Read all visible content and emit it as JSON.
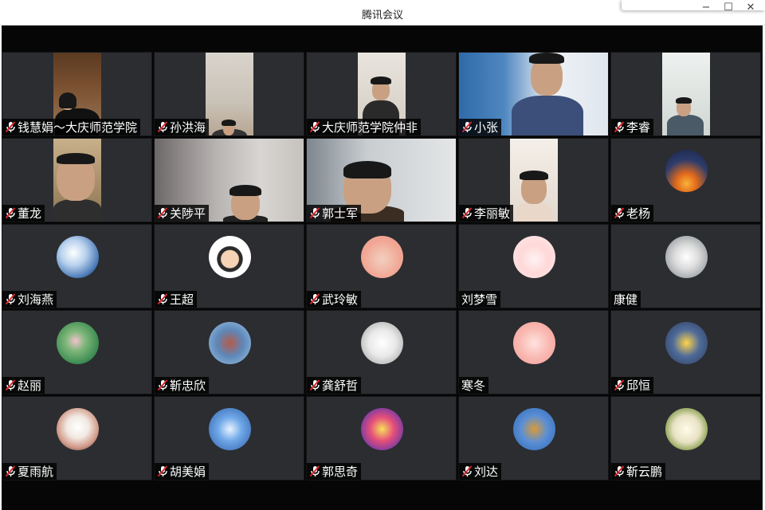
{
  "window": {
    "title": "腾讯会议",
    "controls": {
      "minimize": "−",
      "maximize": "☐",
      "close": "✕"
    }
  },
  "colors": {
    "stage_background": "#060606",
    "tile_background": "#2b2d31",
    "muted_mic": "#d9262c"
  },
  "participants": [
    {
      "name": "钱慧娟～大庆师范学院",
      "muted": true,
      "video": true
    },
    {
      "name": "孙洪海",
      "muted": true,
      "video": true
    },
    {
      "name": "大庆师范学院仲非",
      "muted": true,
      "video": true
    },
    {
      "name": "小张",
      "muted": true,
      "video": true
    },
    {
      "name": "李睿",
      "muted": true,
      "video": true
    },
    {
      "name": "董龙",
      "muted": true,
      "video": true
    },
    {
      "name": "关陟平",
      "muted": true,
      "video": true
    },
    {
      "name": "郭士军",
      "muted": true,
      "video": true
    },
    {
      "name": "李丽敏",
      "muted": true,
      "video": true
    },
    {
      "name": "老杨",
      "muted": true,
      "video": false,
      "avatar": "sunset-avatar"
    },
    {
      "name": "刘海燕",
      "muted": true,
      "video": false,
      "avatar": "blossom-avatar"
    },
    {
      "name": "王超",
      "muted": true,
      "video": false,
      "avatar": "cartoon-boy-avatar"
    },
    {
      "name": "武玲敏",
      "muted": true,
      "video": false,
      "avatar": "cartoon-girl-avatar"
    },
    {
      "name": "刘梦雪",
      "muted": false,
      "video": false,
      "avatar": "pig-avatar"
    },
    {
      "name": "康健",
      "muted": false,
      "video": false,
      "avatar": "figure-avatar"
    },
    {
      "name": "赵丽",
      "muted": true,
      "video": false,
      "avatar": "lotus-avatar"
    },
    {
      "name": "靳忠欣",
      "muted": true,
      "video": false,
      "avatar": "tower-avatar"
    },
    {
      "name": "龚舒哲",
      "muted": true,
      "video": false,
      "avatar": "sketch-avatar"
    },
    {
      "name": "寒冬",
      "muted": false,
      "video": false,
      "avatar": "girl-pink-avatar"
    },
    {
      "name": "邱恒",
      "muted": true,
      "video": false,
      "avatar": "street-avatar"
    },
    {
      "name": "夏雨航",
      "muted": true,
      "video": false,
      "avatar": "couple-avatar"
    },
    {
      "name": "胡美娟",
      "muted": true,
      "video": false,
      "avatar": "blue-scene-avatar"
    },
    {
      "name": "郭思奇",
      "muted": true,
      "video": false,
      "avatar": "colorful-avatar"
    },
    {
      "name": "刘达",
      "muted": true,
      "video": false,
      "avatar": "tree-avatar"
    },
    {
      "name": "靳云鹏",
      "muted": true,
      "video": false,
      "avatar": "sunglasses-avatar"
    }
  ]
}
